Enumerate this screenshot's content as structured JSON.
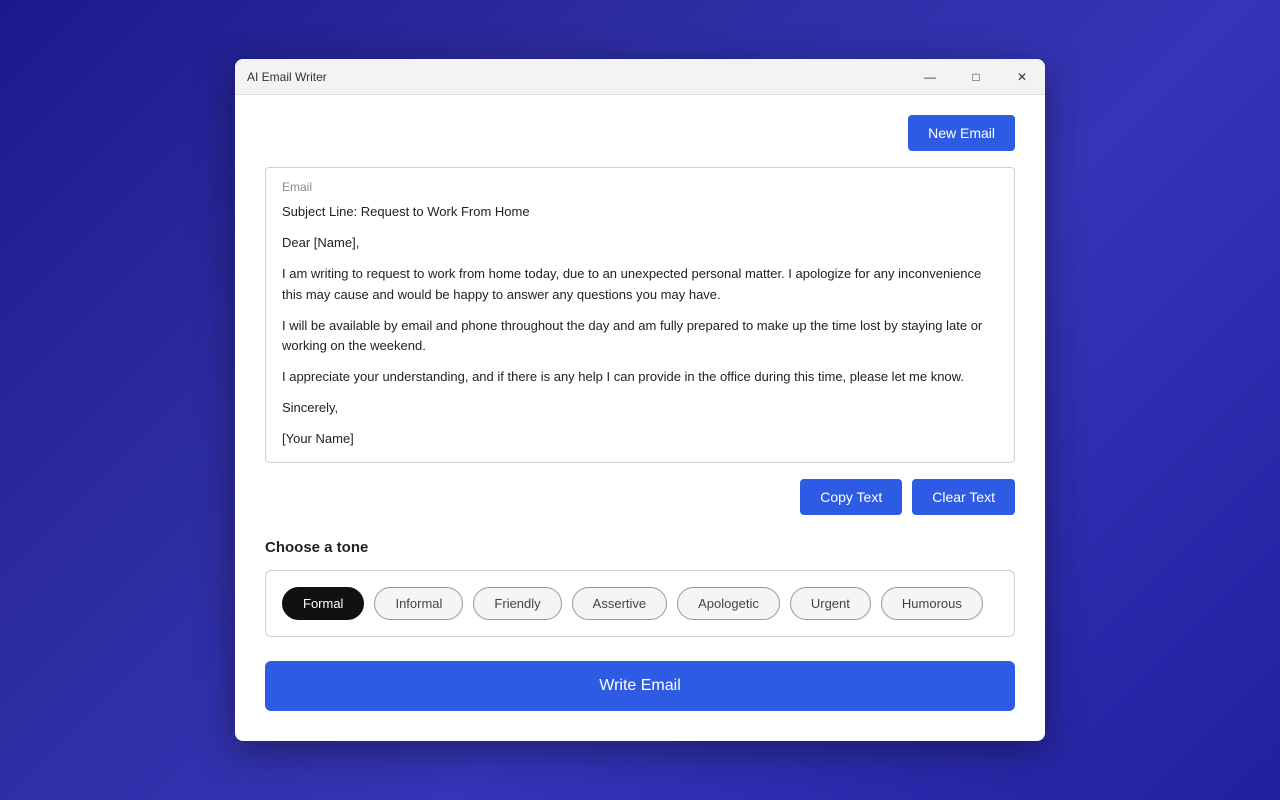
{
  "window": {
    "title": "AI Email Writer",
    "controls": {
      "minimize": "—",
      "maximize": "□",
      "close": "✕"
    }
  },
  "header": {
    "new_email_label": "New Email"
  },
  "email": {
    "label": "Email",
    "subject": "Subject Line: Request to Work From Home",
    "greeting": "Dear [Name],",
    "body1": "I am writing to request to work from home today, due to an unexpected personal matter. I apologize for any inconvenience this may cause and would be happy to answer any questions you may have.",
    "body2": "I will be available by email and phone throughout the day and am fully prepared to make up the time lost by staying late or working on the weekend.",
    "body3": "I appreciate your understanding, and if there is any help I can provide in the office during this time, please let me know.",
    "closing": "Sincerely,",
    "signature": "[Your Name]"
  },
  "actions": {
    "copy_text": "Copy Text",
    "clear_text": "Clear Text"
  },
  "tone": {
    "label": "Choose a tone",
    "options": [
      {
        "id": "formal",
        "label": "Formal",
        "active": true
      },
      {
        "id": "informal",
        "label": "Informal",
        "active": false
      },
      {
        "id": "friendly",
        "label": "Friendly",
        "active": false
      },
      {
        "id": "assertive",
        "label": "Assertive",
        "active": false
      },
      {
        "id": "apologetic",
        "label": "Apologetic",
        "active": false
      },
      {
        "id": "urgent",
        "label": "Urgent",
        "active": false
      },
      {
        "id": "humorous",
        "label": "Humorous",
        "active": false
      }
    ]
  },
  "write_email_label": "Write Email"
}
